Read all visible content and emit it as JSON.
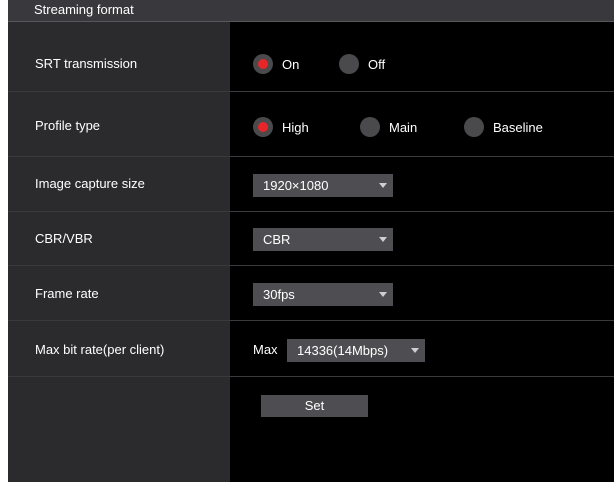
{
  "section_title": "Streaming format",
  "srt": {
    "label": "SRT transmission",
    "on": "On",
    "off": "Off",
    "selected": "on"
  },
  "profile": {
    "label": "Profile type",
    "high": "High",
    "main": "Main",
    "baseline": "Baseline",
    "selected": "high"
  },
  "capture": {
    "label": "Image capture size",
    "value": "1920×1080"
  },
  "cbrvbr": {
    "label": "CBR/VBR",
    "value": "CBR"
  },
  "framerate": {
    "label": "Frame rate",
    "value": "30fps"
  },
  "bitrate": {
    "label": "Max bit rate(per client)",
    "prefix": "Max",
    "value": "14336(14Mbps)"
  },
  "actions": {
    "set_label": "Set"
  },
  "colors": {
    "selected_radio": "#e8262a",
    "panel_left": "#2b2b2e",
    "panel_right": "#000000"
  }
}
